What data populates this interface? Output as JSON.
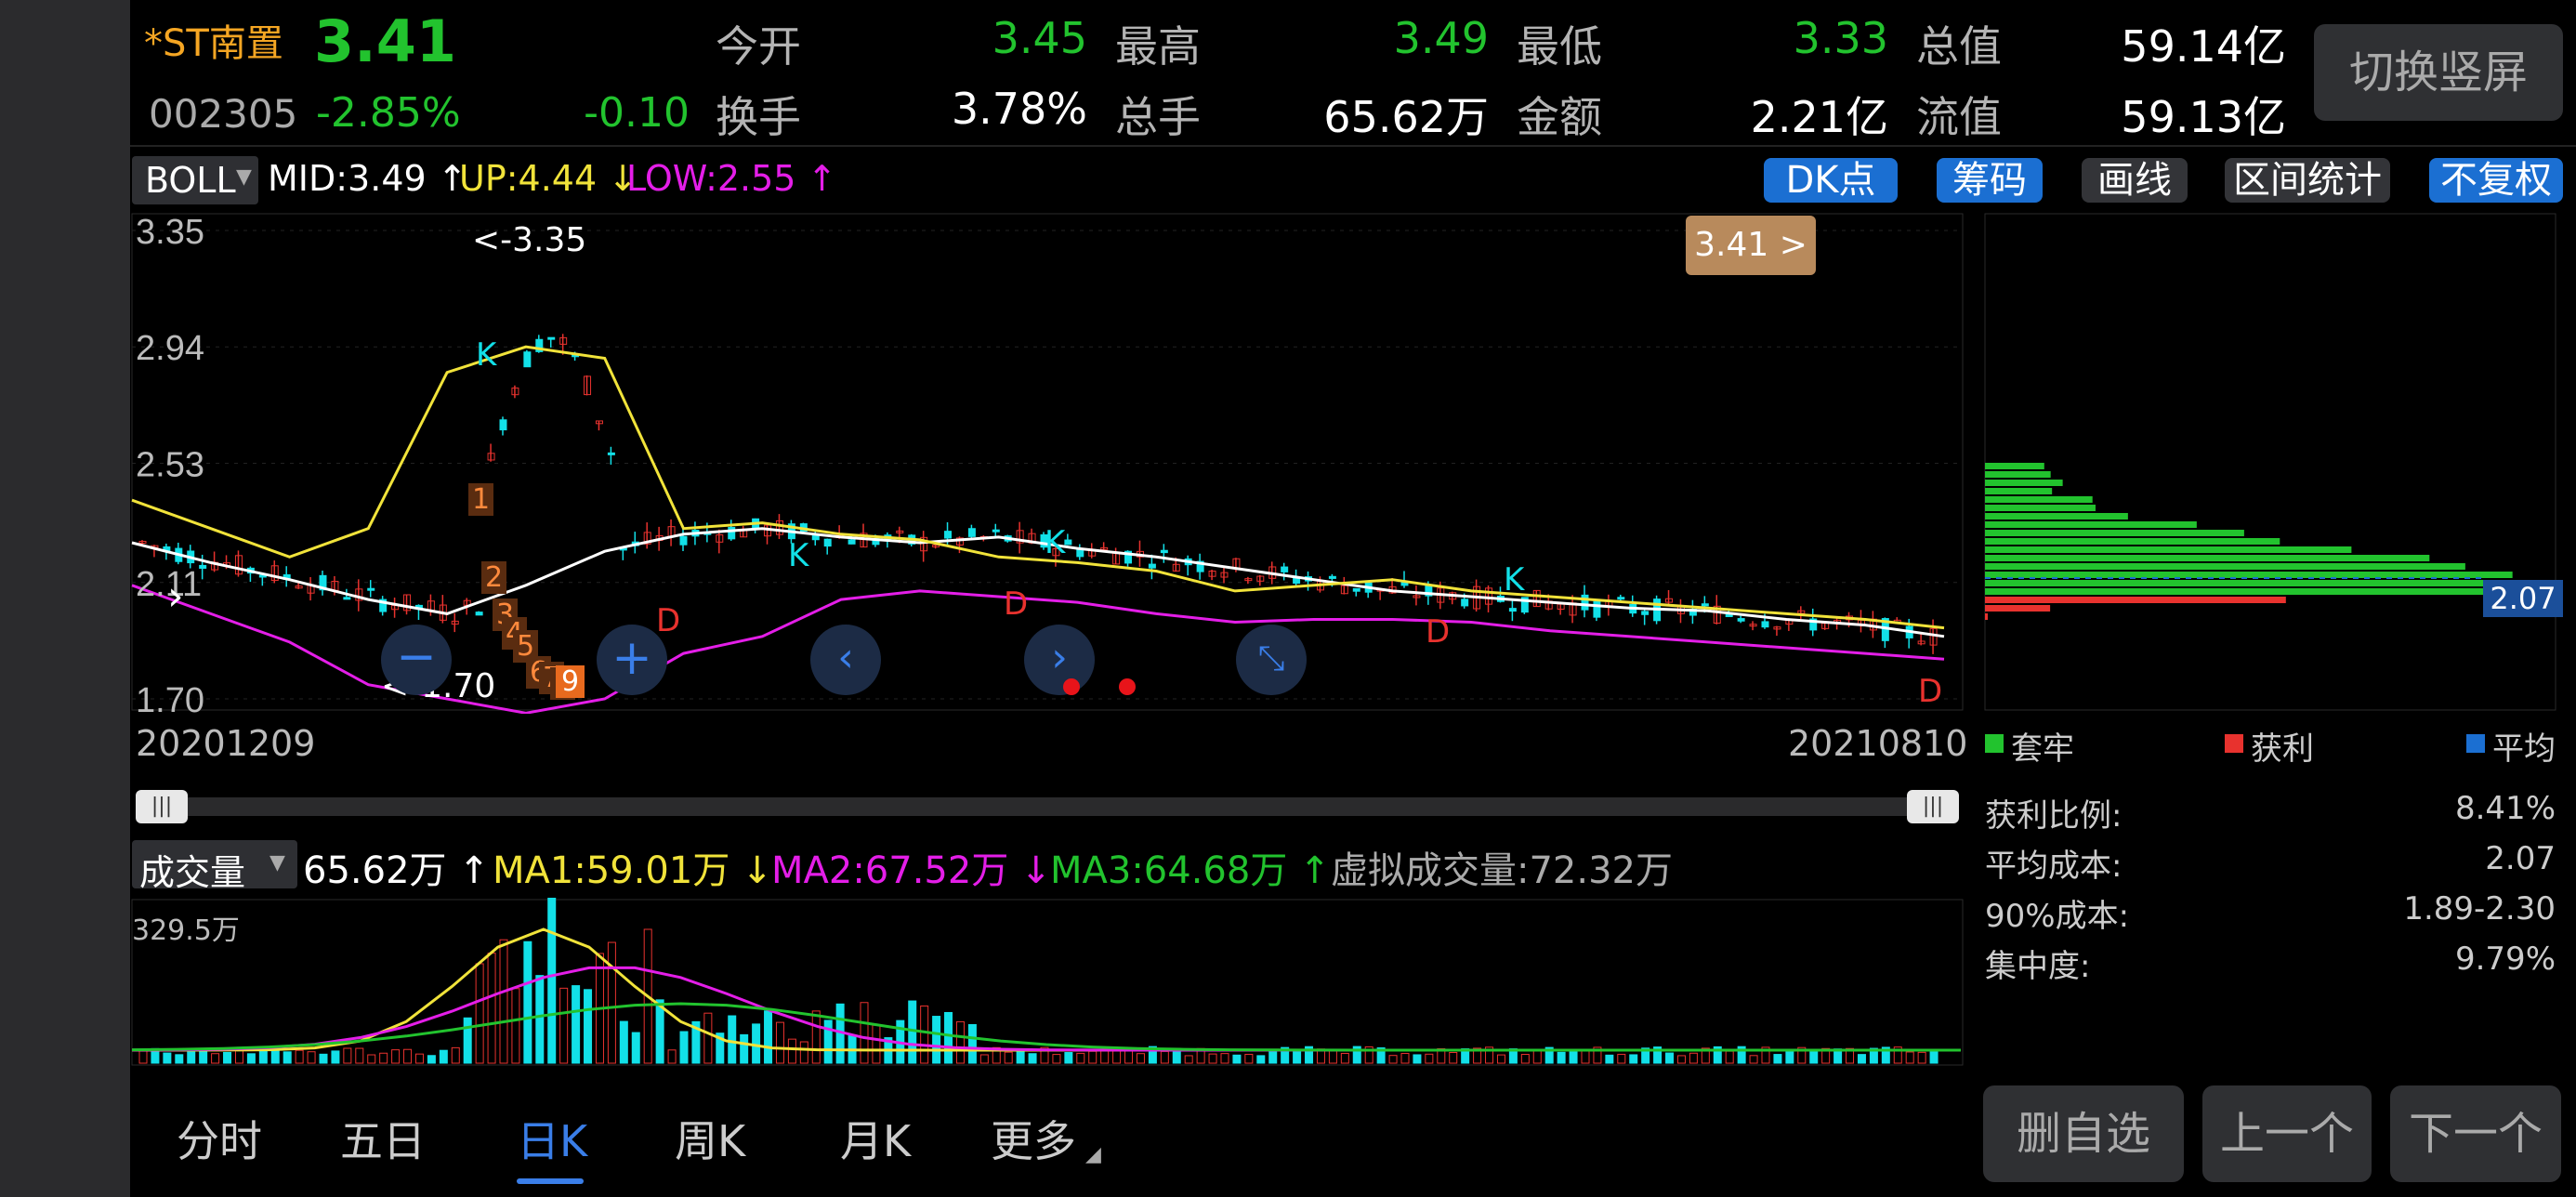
{
  "quote": {
    "name": "*ST南置",
    "code": "002305",
    "price": "3.41",
    "change_pct": "-2.85%",
    "change": "-0.10",
    "switch_label": "切换竖屏",
    "stats": [
      {
        "label": "今开",
        "value": "3.45"
      },
      {
        "label": "最高",
        "value": "3.49"
      },
      {
        "label": "最低",
        "value": "3.33"
      },
      {
        "label": "总值",
        "value": "59.14亿"
      },
      {
        "label": "换手",
        "value": "3.78%"
      },
      {
        "label": "总手",
        "value": "65.62万"
      },
      {
        "label": "金额",
        "value": "2.21亿"
      },
      {
        "label": "流值",
        "value": "59.13亿"
      }
    ]
  },
  "indicator": {
    "name": "BOLL",
    "mid": "MID:3.49",
    "up": "UP:4.44",
    "low": "LOW:2.55",
    "buttons": [
      "DK点",
      "筹码",
      "画线",
      "区间统计",
      "不复权"
    ]
  },
  "kchart": {
    "price_badge": "3.41 >",
    "start_date": "20201209",
    "end_date": "20210810",
    "high_label": "<-3.35",
    "low_label": "<-1.70",
    "dk_markers": [
      "K",
      "K",
      "K",
      "K",
      "D",
      "D",
      "D",
      "D",
      "D"
    ],
    "td_numbers": [
      "1",
      "2",
      "3",
      "4",
      "5",
      "6",
      "7",
      "8",
      "9"
    ]
  },
  "volume": {
    "name": "成交量",
    "current": "65.62万",
    "ma1": "MA1:59.01万",
    "ma2": "MA2:67.52万",
    "ma3": "MA3:64.68万",
    "virtual": "虚拟成交量:72.32万",
    "max": "329.5万"
  },
  "chip": {
    "price": "2.07",
    "legend": [
      "套牢",
      "获利",
      "平均"
    ],
    "stats": [
      {
        "label": "获利比例:",
        "value": "8.41%"
      },
      {
        "label": "平均成本:",
        "value": "2.07"
      },
      {
        "label": "90%成本:",
        "value": "1.89-2.30"
      },
      {
        "label": "集中度:",
        "value": "9.79%"
      }
    ]
  },
  "tabs": [
    "分时",
    "五日",
    "日K",
    "周K",
    "月K",
    "更多"
  ],
  "actions": [
    "删自选",
    "上一个",
    "下一个"
  ],
  "colors": {
    "up": "#e8322e",
    "down": "#12e0e8",
    "mid": "#ffffff",
    "upper": "#f1e33a",
    "lower": "#e41ee8",
    "accent": "#1b6fd2"
  },
  "chart_data": {
    "type": "line",
    "title": "",
    "x": [
      "20201209",
      "20210810"
    ],
    "ylim": [
      1.7,
      3.35
    ],
    "yticks": [
      "3.35",
      "2.94",
      "2.53",
      "2.11",
      "1.70"
    ],
    "series": [
      {
        "name": "MID",
        "values": [
          2.25,
          2.18,
          2.12,
          2.05,
          2.0,
          2.1,
          2.22,
          2.28,
          2.3,
          2.27,
          2.25,
          2.27,
          2.23,
          2.2,
          2.16,
          2.12,
          2.08,
          2.06,
          2.04,
          2.02,
          2.01,
          1.98,
          1.96,
          1.92
        ]
      },
      {
        "name": "UP",
        "values": [
          2.4,
          2.3,
          2.2,
          2.3,
          2.85,
          2.94,
          2.9,
          2.3,
          2.32,
          2.28,
          2.26,
          2.2,
          2.18,
          2.15,
          2.08,
          2.1,
          2.12,
          2.08,
          2.06,
          2.04,
          2.02,
          2.0,
          1.98,
          1.95
        ]
      },
      {
        "name": "LOW",
        "values": [
          2.1,
          2.0,
          1.9,
          1.75,
          1.7,
          1.65,
          1.7,
          1.86,
          1.92,
          2.05,
          2.08,
          2.06,
          2.04,
          2.0,
          1.97,
          1.98,
          1.98,
          1.97,
          1.94,
          1.92,
          1.9,
          1.88,
          1.86,
          1.84
        ]
      }
    ]
  }
}
